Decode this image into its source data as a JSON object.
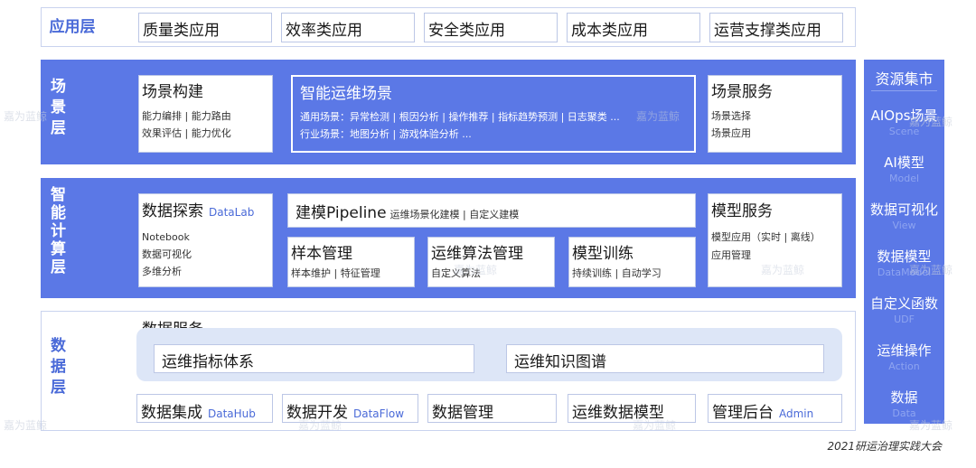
{
  "app_layer": {
    "label": "应用层",
    "items": [
      "质量类应用",
      "效率类应用",
      "安全类应用",
      "成本类应用",
      "运营支撑类应用"
    ]
  },
  "scene_layer": {
    "label": "场景层",
    "build": {
      "title": "场景构建",
      "lines": [
        "能力编排 | 能力路由",
        "效果评估 | 能力优化"
      ]
    },
    "aiops": {
      "title": "智能运维场景",
      "lines": [
        "通用场景：异常检测 | 根因分析 | 操作推荐 | 指标趋势预测 | 日志聚类 ...",
        "行业场景：地图分析 | 游戏体验分析 ..."
      ]
    },
    "service": {
      "title": "场景服务",
      "lines": [
        "场景选择",
        "场景应用"
      ]
    }
  },
  "compute_layer": {
    "label": "智能计算层",
    "explore": {
      "title": "数据探索",
      "en": "DataLab",
      "lines": [
        "Notebook",
        "数据可视化",
        "多维分析"
      ]
    },
    "pipeline": {
      "title": "建模Pipeline",
      "sub": "运维场景化建模 | 自定义建模"
    },
    "sample": {
      "title": "样本管理",
      "sub": "样本维护 | 特征管理"
    },
    "algo": {
      "title": "运维算法管理",
      "sub": "自定义算法"
    },
    "train": {
      "title": "模型训练",
      "sub": "持续训练 | 自动学习"
    },
    "model_service": {
      "title": "模型服务",
      "lines": [
        "模型应用（实时 | 离线）",
        "应用管理"
      ]
    }
  },
  "data_layer": {
    "label": "数据层",
    "service_title": "数据服务",
    "metric_system": "运维指标体系",
    "knowledge_graph": "运维知识图谱",
    "items": [
      {
        "zh": "数据集成",
        "en": "DataHub"
      },
      {
        "zh": "数据开发",
        "en": "DataFlow"
      },
      {
        "zh": "数据管理",
        "en": ""
      },
      {
        "zh": "运维数据模型",
        "en": ""
      },
      {
        "zh": "管理后台",
        "en": "Admin"
      }
    ]
  },
  "sidebar": {
    "title": "资源集市",
    "items": [
      {
        "zh": "AIOps场景",
        "en": "Scene"
      },
      {
        "zh": "AI模型",
        "en": "Model"
      },
      {
        "zh": "数据可视化",
        "en": "View"
      },
      {
        "zh": "数据模型",
        "en": "DataModel"
      },
      {
        "zh": "自定义函数",
        "en": "UDF"
      },
      {
        "zh": "运维操作",
        "en": "Action"
      },
      {
        "zh": "数据",
        "en": "Data"
      }
    ]
  },
  "watermark": "嘉为蓝鲸",
  "footer": "2021研运治理实践大会",
  "colors": {
    "primary": "#5b78e6",
    "label": "#4a6ad8",
    "border": "#bcc7e6"
  }
}
